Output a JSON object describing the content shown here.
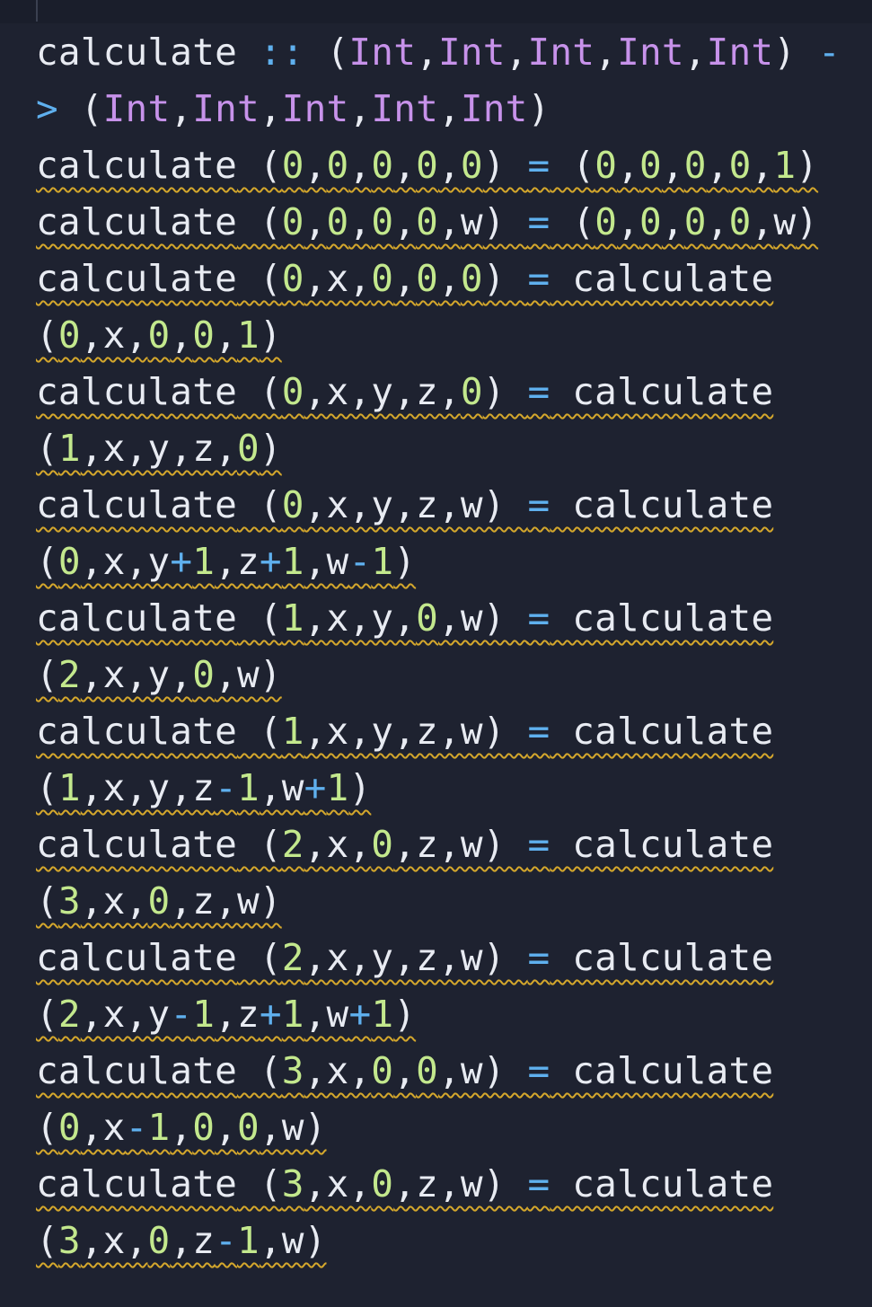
{
  "editor": {
    "colors": {
      "background": "#1e2230",
      "text": "#e8ebf2",
      "operator": "#5fb0ee",
      "type": "#c792ea",
      "number": "#c3e88d",
      "warning_squiggle": "#d4a72c"
    },
    "lines": [
      {
        "squiggle": false,
        "tokens": [
          {
            "t": "calculate",
            "c": "kw"
          },
          {
            "t": " ",
            "c": "punc"
          },
          {
            "t": "::",
            "c": "op"
          },
          {
            "t": " (",
            "c": "punc"
          },
          {
            "t": "Int",
            "c": "ty"
          },
          {
            "t": ",",
            "c": "punc"
          },
          {
            "t": "Int",
            "c": "ty"
          },
          {
            "t": ",",
            "c": "punc"
          },
          {
            "t": "Int",
            "c": "ty"
          },
          {
            "t": ",",
            "c": "punc"
          },
          {
            "t": "Int",
            "c": "ty"
          },
          {
            "t": ",",
            "c": "punc"
          },
          {
            "t": "Int",
            "c": "ty"
          },
          {
            "t": ") ",
            "c": "punc"
          },
          {
            "t": "-",
            "c": "op"
          }
        ]
      },
      {
        "squiggle": false,
        "tokens": [
          {
            "t": ">",
            "c": "op"
          },
          {
            "t": " (",
            "c": "punc"
          },
          {
            "t": "Int",
            "c": "ty"
          },
          {
            "t": ",",
            "c": "punc"
          },
          {
            "t": "Int",
            "c": "ty"
          },
          {
            "t": ",",
            "c": "punc"
          },
          {
            "t": "Int",
            "c": "ty"
          },
          {
            "t": ",",
            "c": "punc"
          },
          {
            "t": "Int",
            "c": "ty"
          },
          {
            "t": ",",
            "c": "punc"
          },
          {
            "t": "Int",
            "c": "ty"
          },
          {
            "t": ")",
            "c": "punc"
          }
        ]
      },
      {
        "squiggle": true,
        "tokens": [
          {
            "t": "calculate",
            "c": "kw"
          },
          {
            "t": " (",
            "c": "punc"
          },
          {
            "t": "0",
            "c": "num"
          },
          {
            "t": ",",
            "c": "punc"
          },
          {
            "t": "0",
            "c": "num"
          },
          {
            "t": ",",
            "c": "punc"
          },
          {
            "t": "0",
            "c": "num"
          },
          {
            "t": ",",
            "c": "punc"
          },
          {
            "t": "0",
            "c": "num"
          },
          {
            "t": ",",
            "c": "punc"
          },
          {
            "t": "0",
            "c": "num"
          },
          {
            "t": ") ",
            "c": "punc"
          },
          {
            "t": "=",
            "c": "op"
          },
          {
            "t": " (",
            "c": "punc"
          },
          {
            "t": "0",
            "c": "num"
          },
          {
            "t": ",",
            "c": "punc"
          },
          {
            "t": "0",
            "c": "num"
          },
          {
            "t": ",",
            "c": "punc"
          },
          {
            "t": "0",
            "c": "num"
          },
          {
            "t": ",",
            "c": "punc"
          },
          {
            "t": "0",
            "c": "num"
          },
          {
            "t": ",",
            "c": "punc"
          },
          {
            "t": "1",
            "c": "num"
          },
          {
            "t": ")",
            "c": "punc"
          }
        ]
      },
      {
        "squiggle": true,
        "tokens": [
          {
            "t": "calculate",
            "c": "kw"
          },
          {
            "t": " (",
            "c": "punc"
          },
          {
            "t": "0",
            "c": "num"
          },
          {
            "t": ",",
            "c": "punc"
          },
          {
            "t": "0",
            "c": "num"
          },
          {
            "t": ",",
            "c": "punc"
          },
          {
            "t": "0",
            "c": "num"
          },
          {
            "t": ",",
            "c": "punc"
          },
          {
            "t": "0",
            "c": "num"
          },
          {
            "t": ",",
            "c": "punc"
          },
          {
            "t": "w",
            "c": "var"
          },
          {
            "t": ") ",
            "c": "punc"
          },
          {
            "t": "=",
            "c": "op"
          },
          {
            "t": " (",
            "c": "punc"
          },
          {
            "t": "0",
            "c": "num"
          },
          {
            "t": ",",
            "c": "punc"
          },
          {
            "t": "0",
            "c": "num"
          },
          {
            "t": ",",
            "c": "punc"
          },
          {
            "t": "0",
            "c": "num"
          },
          {
            "t": ",",
            "c": "punc"
          },
          {
            "t": "0",
            "c": "num"
          },
          {
            "t": ",",
            "c": "punc"
          },
          {
            "t": "w",
            "c": "var"
          },
          {
            "t": ")",
            "c": "punc"
          }
        ]
      },
      {
        "squiggle": true,
        "tokens": [
          {
            "t": "calculate",
            "c": "kw"
          },
          {
            "t": " (",
            "c": "punc"
          },
          {
            "t": "0",
            "c": "num"
          },
          {
            "t": ",x,",
            "c": "punc"
          },
          {
            "t": "0",
            "c": "num"
          },
          {
            "t": ",",
            "c": "punc"
          },
          {
            "t": "0",
            "c": "num"
          },
          {
            "t": ",",
            "c": "punc"
          },
          {
            "t": "0",
            "c": "num"
          },
          {
            "t": ") ",
            "c": "punc"
          },
          {
            "t": "=",
            "c": "op"
          },
          {
            "t": " calculate",
            "c": "kw"
          }
        ]
      },
      {
        "squiggle": true,
        "tokens": [
          {
            "t": "(",
            "c": "punc"
          },
          {
            "t": "0",
            "c": "num"
          },
          {
            "t": ",x,",
            "c": "punc"
          },
          {
            "t": "0",
            "c": "num"
          },
          {
            "t": ",",
            "c": "punc"
          },
          {
            "t": "0",
            "c": "num"
          },
          {
            "t": ",",
            "c": "punc"
          },
          {
            "t": "1",
            "c": "num"
          },
          {
            "t": ")",
            "c": "punc"
          }
        ]
      },
      {
        "squiggle": true,
        "tokens": [
          {
            "t": "calculate",
            "c": "kw"
          },
          {
            "t": " (",
            "c": "punc"
          },
          {
            "t": "0",
            "c": "num"
          },
          {
            "t": ",x,y,z,",
            "c": "punc"
          },
          {
            "t": "0",
            "c": "num"
          },
          {
            "t": ") ",
            "c": "punc"
          },
          {
            "t": "=",
            "c": "op"
          },
          {
            "t": " calculate",
            "c": "kw"
          }
        ]
      },
      {
        "squiggle": true,
        "tokens": [
          {
            "t": "(",
            "c": "punc"
          },
          {
            "t": "1",
            "c": "num"
          },
          {
            "t": ",x,y,z,",
            "c": "punc"
          },
          {
            "t": "0",
            "c": "num"
          },
          {
            "t": ")",
            "c": "punc"
          }
        ]
      },
      {
        "squiggle": true,
        "tokens": [
          {
            "t": "calculate",
            "c": "kw"
          },
          {
            "t": " (",
            "c": "punc"
          },
          {
            "t": "0",
            "c": "num"
          },
          {
            "t": ",x,y,z,w) ",
            "c": "punc"
          },
          {
            "t": "=",
            "c": "op"
          },
          {
            "t": " calculate",
            "c": "kw"
          }
        ]
      },
      {
        "squiggle": true,
        "tokens": [
          {
            "t": "(",
            "c": "punc"
          },
          {
            "t": "0",
            "c": "num"
          },
          {
            "t": ",x,y",
            "c": "punc"
          },
          {
            "t": "+",
            "c": "op"
          },
          {
            "t": "1",
            "c": "num"
          },
          {
            "t": ",z",
            "c": "punc"
          },
          {
            "t": "+",
            "c": "op"
          },
          {
            "t": "1",
            "c": "num"
          },
          {
            "t": ",w",
            "c": "punc"
          },
          {
            "t": "-",
            "c": "op"
          },
          {
            "t": "1",
            "c": "num"
          },
          {
            "t": ")",
            "c": "punc"
          }
        ]
      },
      {
        "squiggle": true,
        "tokens": [
          {
            "t": "calculate",
            "c": "kw"
          },
          {
            "t": " (",
            "c": "punc"
          },
          {
            "t": "1",
            "c": "num"
          },
          {
            "t": ",x,y,",
            "c": "punc"
          },
          {
            "t": "0",
            "c": "num"
          },
          {
            "t": ",w) ",
            "c": "punc"
          },
          {
            "t": "=",
            "c": "op"
          },
          {
            "t": " calculate",
            "c": "kw"
          }
        ]
      },
      {
        "squiggle": true,
        "tokens": [
          {
            "t": "(",
            "c": "punc"
          },
          {
            "t": "2",
            "c": "num"
          },
          {
            "t": ",x,y,",
            "c": "punc"
          },
          {
            "t": "0",
            "c": "num"
          },
          {
            "t": ",w)",
            "c": "punc"
          }
        ]
      },
      {
        "squiggle": true,
        "tokens": [
          {
            "t": "calculate",
            "c": "kw"
          },
          {
            "t": " (",
            "c": "punc"
          },
          {
            "t": "1",
            "c": "num"
          },
          {
            "t": ",x,y,z,w) ",
            "c": "punc"
          },
          {
            "t": "=",
            "c": "op"
          },
          {
            "t": " calculate",
            "c": "kw"
          }
        ]
      },
      {
        "squiggle": true,
        "tokens": [
          {
            "t": "(",
            "c": "punc"
          },
          {
            "t": "1",
            "c": "num"
          },
          {
            "t": ",x,y,z",
            "c": "punc"
          },
          {
            "t": "-",
            "c": "op"
          },
          {
            "t": "1",
            "c": "num"
          },
          {
            "t": ",w",
            "c": "punc"
          },
          {
            "t": "+",
            "c": "op"
          },
          {
            "t": "1",
            "c": "num"
          },
          {
            "t": ")",
            "c": "punc"
          }
        ]
      },
      {
        "squiggle": true,
        "tokens": [
          {
            "t": "calculate",
            "c": "kw"
          },
          {
            "t": " (",
            "c": "punc"
          },
          {
            "t": "2",
            "c": "num"
          },
          {
            "t": ",x,",
            "c": "punc"
          },
          {
            "t": "0",
            "c": "num"
          },
          {
            "t": ",z,w) ",
            "c": "punc"
          },
          {
            "t": "=",
            "c": "op"
          },
          {
            "t": " calculate",
            "c": "kw"
          }
        ]
      },
      {
        "squiggle": true,
        "tokens": [
          {
            "t": "(",
            "c": "punc"
          },
          {
            "t": "3",
            "c": "num"
          },
          {
            "t": ",x,",
            "c": "punc"
          },
          {
            "t": "0",
            "c": "num"
          },
          {
            "t": ",z,w)",
            "c": "punc"
          }
        ]
      },
      {
        "squiggle": true,
        "tokens": [
          {
            "t": "calculate",
            "c": "kw"
          },
          {
            "t": " (",
            "c": "punc"
          },
          {
            "t": "2",
            "c": "num"
          },
          {
            "t": ",x,y,z,w) ",
            "c": "punc"
          },
          {
            "t": "=",
            "c": "op"
          },
          {
            "t": " calculate",
            "c": "kw"
          }
        ]
      },
      {
        "squiggle": true,
        "tokens": [
          {
            "t": "(",
            "c": "punc"
          },
          {
            "t": "2",
            "c": "num"
          },
          {
            "t": ",x,y",
            "c": "punc"
          },
          {
            "t": "-",
            "c": "op"
          },
          {
            "t": "1",
            "c": "num"
          },
          {
            "t": ",z",
            "c": "punc"
          },
          {
            "t": "+",
            "c": "op"
          },
          {
            "t": "1",
            "c": "num"
          },
          {
            "t": ",w",
            "c": "punc"
          },
          {
            "t": "+",
            "c": "op"
          },
          {
            "t": "1",
            "c": "num"
          },
          {
            "t": ")",
            "c": "punc"
          }
        ]
      },
      {
        "squiggle": true,
        "tokens": [
          {
            "t": "calculate",
            "c": "kw"
          },
          {
            "t": " (",
            "c": "punc"
          },
          {
            "t": "3",
            "c": "num"
          },
          {
            "t": ",x,",
            "c": "punc"
          },
          {
            "t": "0",
            "c": "num"
          },
          {
            "t": ",",
            "c": "punc"
          },
          {
            "t": "0",
            "c": "num"
          },
          {
            "t": ",w) ",
            "c": "punc"
          },
          {
            "t": "=",
            "c": "op"
          },
          {
            "t": " calculate",
            "c": "kw"
          }
        ]
      },
      {
        "squiggle": true,
        "tokens": [
          {
            "t": "(",
            "c": "punc"
          },
          {
            "t": "0",
            "c": "num"
          },
          {
            "t": ",x",
            "c": "punc"
          },
          {
            "t": "-",
            "c": "op"
          },
          {
            "t": "1",
            "c": "num"
          },
          {
            "t": ",",
            "c": "punc"
          },
          {
            "t": "0",
            "c": "num"
          },
          {
            "t": ",",
            "c": "punc"
          },
          {
            "t": "0",
            "c": "num"
          },
          {
            "t": ",w)",
            "c": "punc"
          }
        ]
      },
      {
        "squiggle": true,
        "tokens": [
          {
            "t": "calculate",
            "c": "kw"
          },
          {
            "t": " (",
            "c": "punc"
          },
          {
            "t": "3",
            "c": "num"
          },
          {
            "t": ",x,",
            "c": "punc"
          },
          {
            "t": "0",
            "c": "num"
          },
          {
            "t": ",z,w) ",
            "c": "punc"
          },
          {
            "t": "=",
            "c": "op"
          },
          {
            "t": " calculate",
            "c": "kw"
          }
        ]
      },
      {
        "squiggle": true,
        "tokens": [
          {
            "t": "(",
            "c": "punc"
          },
          {
            "t": "3",
            "c": "num"
          },
          {
            "t": ",x,",
            "c": "punc"
          },
          {
            "t": "0",
            "c": "num"
          },
          {
            "t": ",z",
            "c": "punc"
          },
          {
            "t": "-",
            "c": "op"
          },
          {
            "t": "1",
            "c": "num"
          },
          {
            "t": ",w)",
            "c": "punc"
          }
        ]
      }
    ]
  }
}
